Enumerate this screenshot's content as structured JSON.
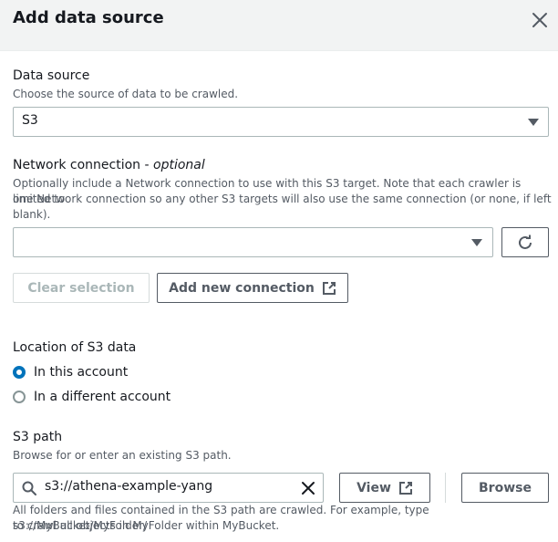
{
  "dialog": {
    "title": "Add data source"
  },
  "data_source": {
    "label": "Data source",
    "description": "Choose the source of data to be crawled.",
    "selected": "S3"
  },
  "network": {
    "label": "Network connection - ",
    "optional": "optional",
    "description_line1": "Optionally include a Network connection to use with this S3 target. Note that each crawler is limited to",
    "description_line2": "one Network connection so any other S3 targets will also use the same connection (or none, if left",
    "description_line3": "blank).",
    "selected": "",
    "clear_label": "Clear selection",
    "add_label": "Add new connection"
  },
  "location": {
    "label": "Location of S3 data",
    "options": [
      {
        "label": "In this account",
        "checked": true
      },
      {
        "label": "In a different account",
        "checked": false
      }
    ]
  },
  "s3_path": {
    "label": "S3 path",
    "description": "Browse for or enter an existing S3 path.",
    "value": "s3://athena-example-yang",
    "view_label": "View",
    "browse_label": "Browse",
    "help_line1": "All folders and files contained in the S3 path are crawled. For example, type s3://MyBucket/MyFolder/",
    "help_line2": "to crawl all objects in MyFolder within MyBucket."
  }
}
